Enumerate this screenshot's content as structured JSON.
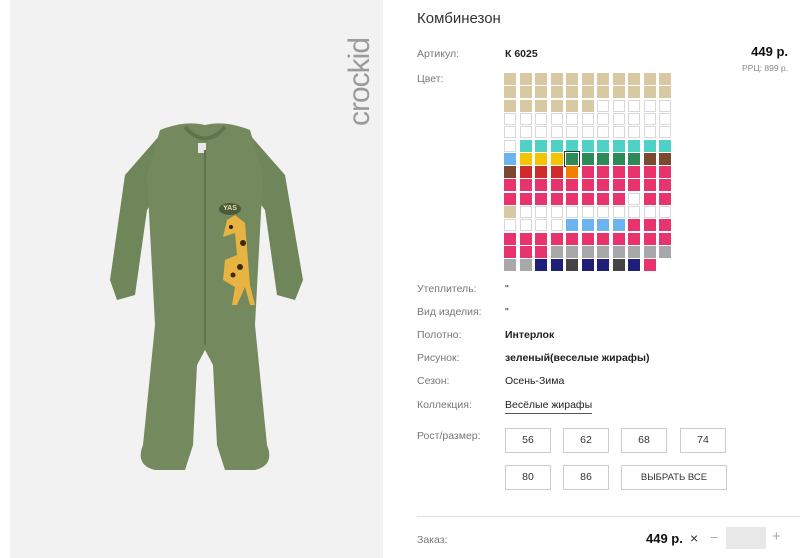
{
  "brand": {
    "logo_text": "crockid"
  },
  "product": {
    "image_alt": "Комбинезон зеленый с жирафом",
    "tag_text": "YAS",
    "title": "Комбинезон",
    "article_label": "Артикул:",
    "article_value": "К 6025",
    "price": "449 р.",
    "rrc": "РРЦ: 899 р.",
    "color_label": "Цвет:",
    "insulation_label": "Утеплитель:",
    "insulation_value": "\"",
    "kind_label": "Вид изделия:",
    "kind_value": "\"",
    "fabric_label": "Полотно:",
    "fabric_value": "Интерлок",
    "pattern_label": "Рисунок:",
    "pattern_value": "зеленый(веселые жирафы)",
    "season_label": "Сезон:",
    "season_value": "Осень-Зима",
    "collection_label": "Коллекция:",
    "collection_value": "Весёлые жирафы",
    "size_label": "Рост/размер:",
    "sizes": [
      "56",
      "62",
      "68",
      "74",
      "80",
      "86"
    ],
    "select_all": "ВЫБРАТЬ ВСЕ"
  },
  "order": {
    "label": "Заказ:",
    "price": "449 р.",
    "times": "×",
    "minus": "−",
    "plus": "+",
    "quantity": ""
  },
  "swatches": [
    [
      "#d9c9a3",
      "#d9c9a3",
      "#d9c9a3",
      "#d9c9a3",
      "#d9c9a3",
      "#d9c9a3",
      "#d9c9a3",
      "#d9c9a3",
      "#d9c9a3",
      "#d9c9a3",
      "#d9c9a3"
    ],
    [
      "#d9c9a3",
      "#d9c9a3",
      "#d9c9a3",
      "#d9c9a3",
      "#d9c9a3",
      "#d9c9a3",
      "#d9c9a3",
      "#d9c9a3",
      "#d9c9a3",
      "#d9c9a3",
      "#d9c9a3"
    ],
    [
      "#d9c9a3",
      "#d9c9a3",
      "#d9c9a3",
      "#d9c9a3",
      "#d9c9a3",
      "#d9c9a3",
      "#ffffff",
      "#ffffff",
      "#ffffff",
      "#ffffff",
      "#ffffff"
    ],
    [
      "#ffffff",
      "#ffffff",
      "#ffffff",
      "#ffffff",
      "#ffffff",
      "#ffffff",
      "#ffffff",
      "#ffffff",
      "#ffffff",
      "#ffffff",
      "#ffffff"
    ],
    [
      "#ffffff",
      "#ffffff",
      "#ffffff",
      "#ffffff",
      "#ffffff",
      "#ffffff",
      "#ffffff",
      "#ffffff",
      "#ffffff",
      "#ffffff",
      "#ffffff"
    ],
    [
      "#ffffff",
      "#4fd1c5",
      "#4fd1c5",
      "#4fd1c5",
      "#4fd1c5",
      "#4fd1c5",
      "#4fd1c5",
      "#4fd1c5",
      "#4fd1c5",
      "#4fd1c5",
      "#4fd1c5"
    ],
    [
      "#6cb4f0",
      "#f5c400",
      "#f5c400",
      "#f5c400",
      "#2e8b57",
      "#2e8b57",
      "#2e8b57",
      "#2e8b57",
      "#2e8b57",
      "#7b4a2e",
      "#7b4a2e"
    ],
    [
      "#7b4a2e",
      "#d12a2a",
      "#d12a2a",
      "#d12a2a",
      "#f08000",
      "#e8336d",
      "#e8336d",
      "#e8336d",
      "#e8336d",
      "#e8336d",
      "#e8336d"
    ],
    [
      "#e8336d",
      "#e8336d",
      "#e8336d",
      "#e8336d",
      "#e8336d",
      "#e8336d",
      "#e8336d",
      "#e8336d",
      "#e8336d",
      "#e8336d",
      "#e8336d"
    ],
    [
      "#e8336d",
      "#e8336d",
      "#e8336d",
      "#e8336d",
      "#e8336d",
      "#e8336d",
      "#e8336d",
      "#e8336d",
      "#ffffff",
      "#e8336d",
      "#e8336d"
    ],
    [
      "#d9c9a3",
      "#ffffff",
      "#ffffff",
      "#ffffff",
      "#ffffff",
      "#ffffff",
      "#ffffff",
      "#ffffff",
      "#ffffff",
      "#ffffff",
      "#ffffff"
    ],
    [
      "#ffffff",
      "#ffffff",
      "#ffffff",
      "#ffffff",
      "#6cb4f0",
      "#6cb4f0",
      "#6cb4f0",
      "#6cb4f0",
      "#e8336d",
      "#e8336d",
      "#e8336d"
    ],
    [
      "#e8336d",
      "#e8336d",
      "#e8336d",
      "#e8336d",
      "#e8336d",
      "#e8336d",
      "#e8336d",
      "#e8336d",
      "#e8336d",
      "#e8336d",
      "#e8336d"
    ],
    [
      "#e8336d",
      "#e8336d",
      "#e8336d",
      "#a8a8a8",
      "#a8a8a8",
      "#a8a8a8",
      "#a8a8a8",
      "#a8a8a8",
      "#a8a8a8",
      "#a8a8a8",
      "#a8a8a8"
    ],
    [
      "#a8a8a8",
      "#a8a8a8",
      "#1f1f7a",
      "#1f1f7a",
      "#444444",
      "#1f1f7a",
      "#1f1f7a",
      "#444444",
      "#1f1f7a",
      "#e8336d"
    ]
  ],
  "selected_swatch": "6-4"
}
